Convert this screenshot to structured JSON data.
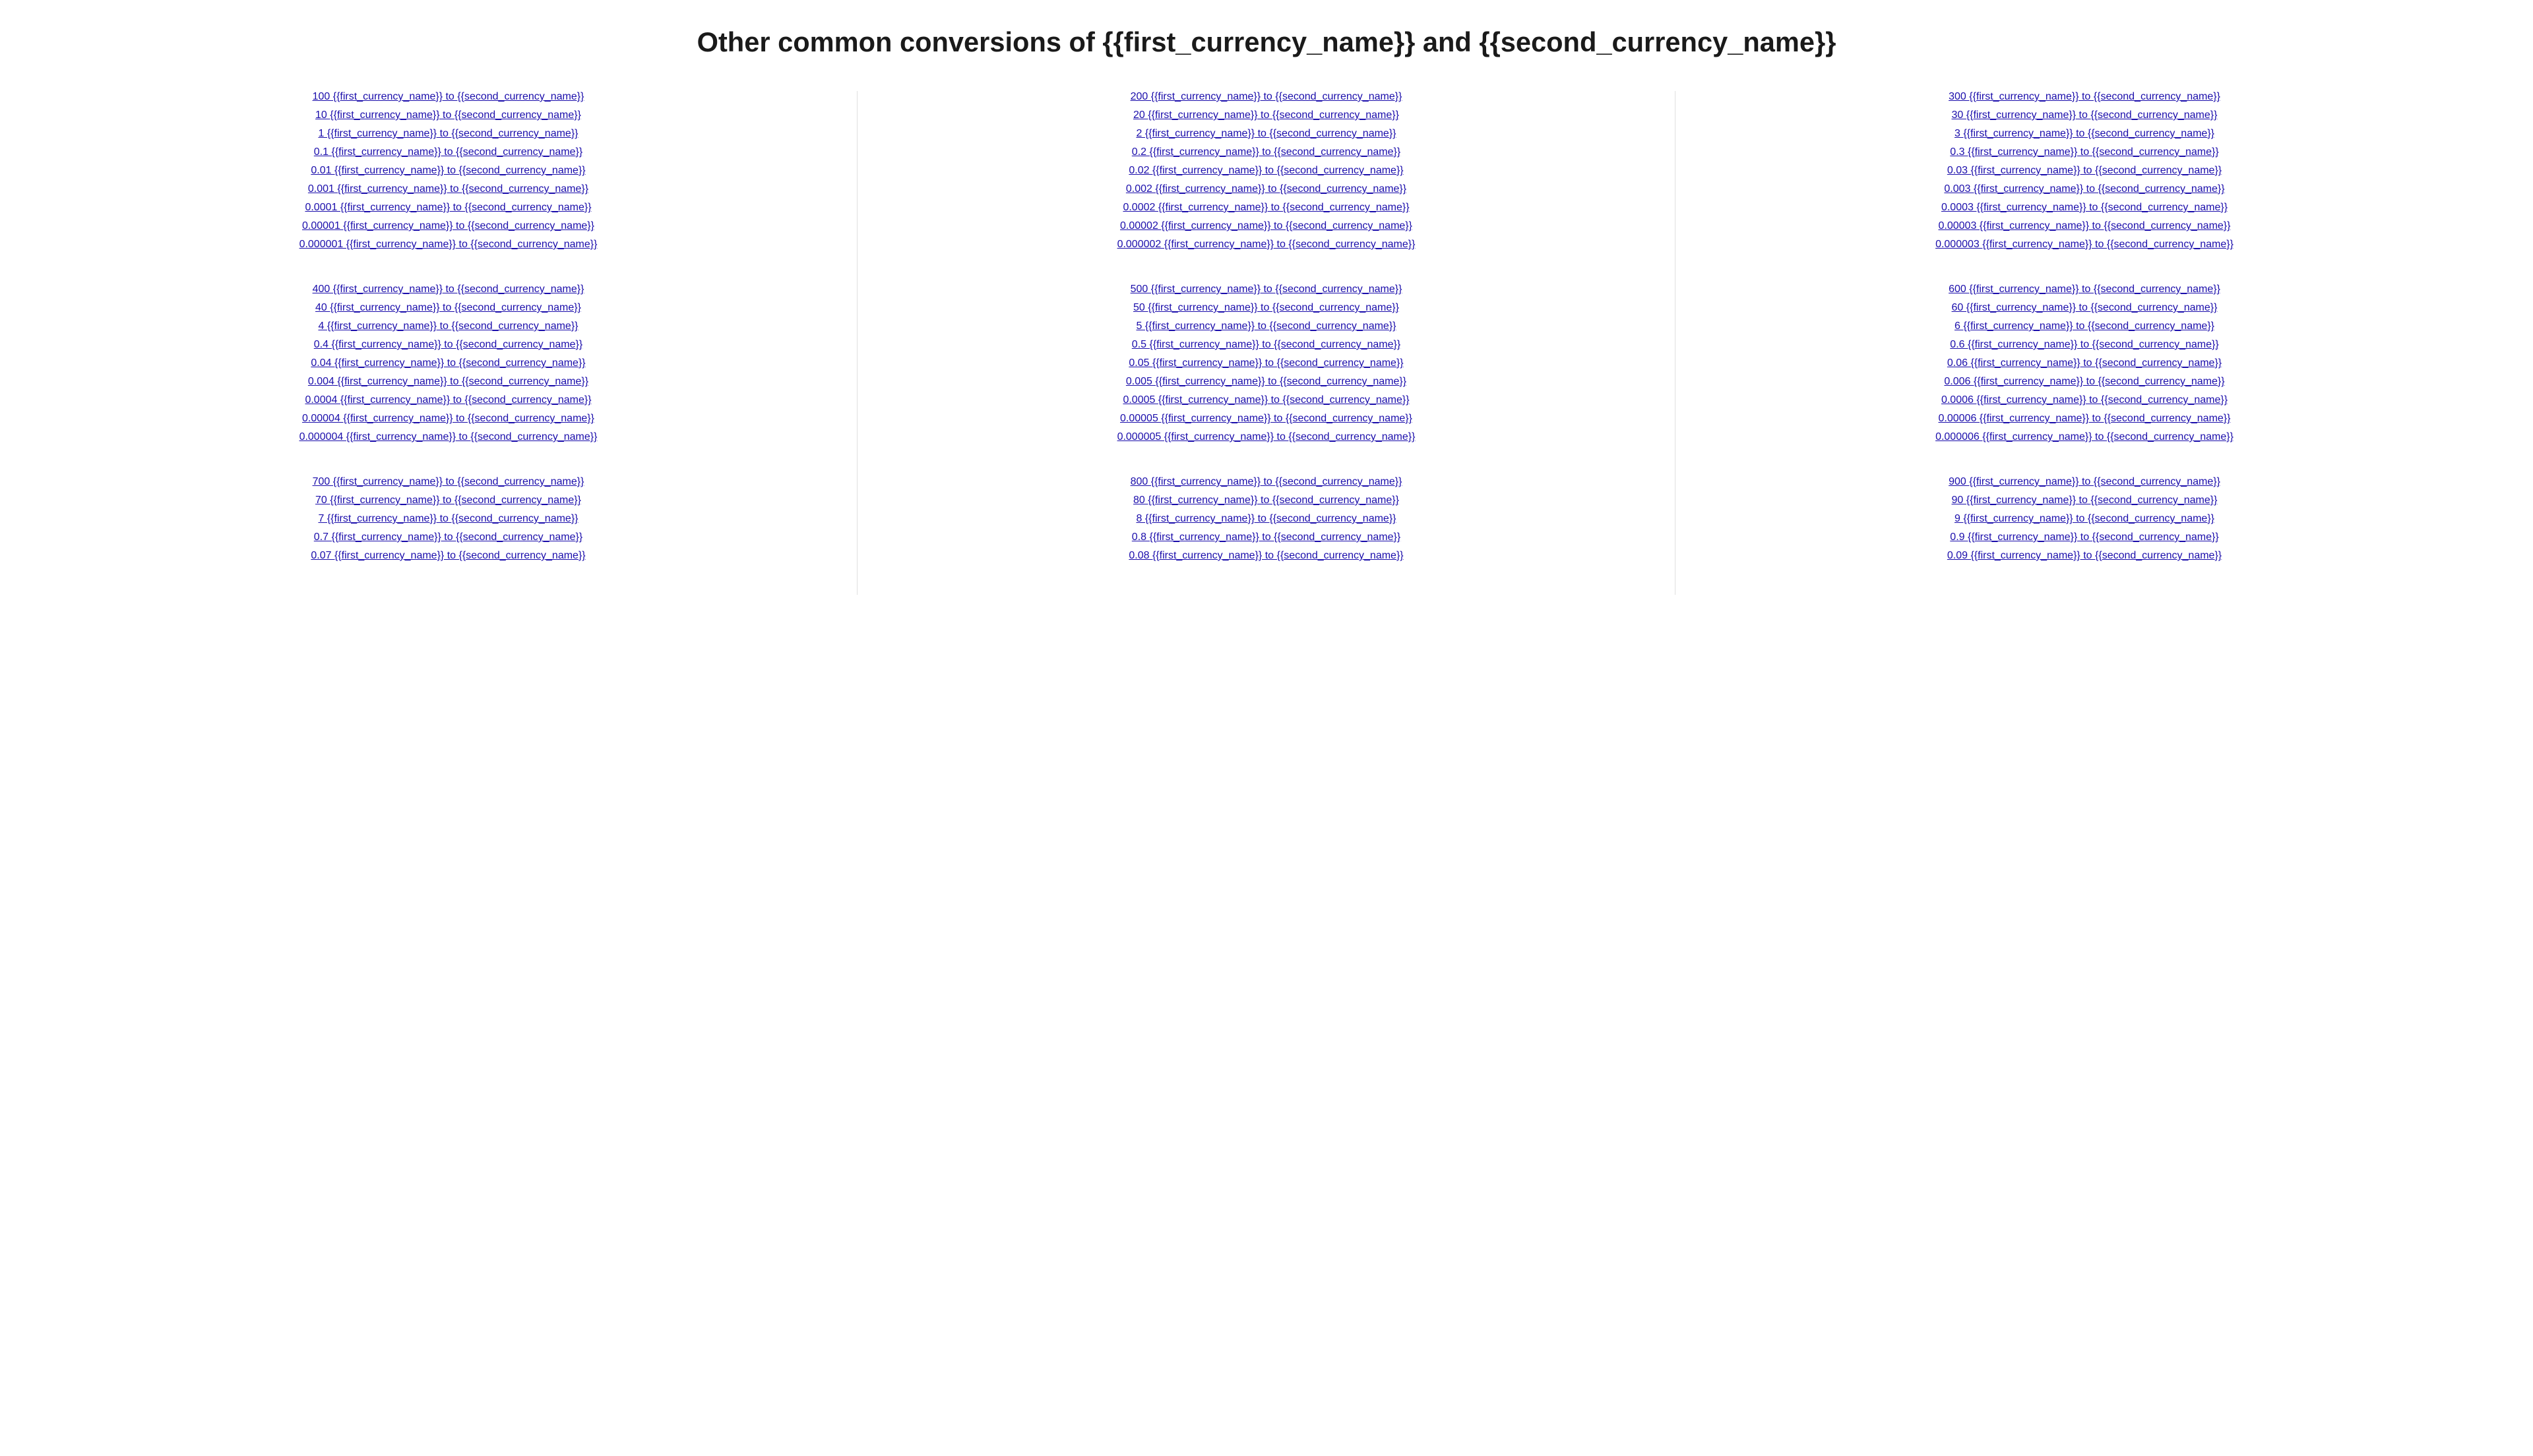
{
  "page": {
    "title": "Other common conversions of {{first_currency_name}} and {{second_currency_name}}"
  },
  "columns": [
    {
      "id": "col1",
      "groups": [
        {
          "id": "g1",
          "links": [
            "100 {{first_currency_name}} to {{second_currency_name}}",
            "10 {{first_currency_name}} to {{second_currency_name}}",
            "1 {{first_currency_name}} to {{second_currency_name}}",
            "0.1 {{first_currency_name}} to {{second_currency_name}}",
            "0.01 {{first_currency_name}} to {{second_currency_name}}",
            "0.001 {{first_currency_name}} to {{second_currency_name}}",
            "0.0001 {{first_currency_name}} to {{second_currency_name}}",
            "0.00001 {{first_currency_name}} to {{second_currency_name}}",
            "0.000001 {{first_currency_name}} to {{second_currency_name}}"
          ]
        },
        {
          "id": "g2",
          "links": [
            "400 {{first_currency_name}} to {{second_currency_name}}",
            "40 {{first_currency_name}} to {{second_currency_name}}",
            "4 {{first_currency_name}} to {{second_currency_name}}",
            "0.4 {{first_currency_name}} to {{second_currency_name}}",
            "0.04 {{first_currency_name}} to {{second_currency_name}}",
            "0.004 {{first_currency_name}} to {{second_currency_name}}",
            "0.0004 {{first_currency_name}} to {{second_currency_name}}",
            "0.00004 {{first_currency_name}} to {{second_currency_name}}",
            "0.000004 {{first_currency_name}} to {{second_currency_name}}"
          ]
        },
        {
          "id": "g3",
          "links": [
            "700 {{first_currency_name}} to {{second_currency_name}}",
            "70 {{first_currency_name}} to {{second_currency_name}}",
            "7 {{first_currency_name}} to {{second_currency_name}}",
            "0.7 {{first_currency_name}} to {{second_currency_name}}",
            "0.07 {{first_currency_name}} to {{second_currency_name}}"
          ]
        }
      ]
    },
    {
      "id": "col2",
      "groups": [
        {
          "id": "g1",
          "links": [
            "200 {{first_currency_name}} to {{second_currency_name}}",
            "20 {{first_currency_name}} to {{second_currency_name}}",
            "2 {{first_currency_name}} to {{second_currency_name}}",
            "0.2 {{first_currency_name}} to {{second_currency_name}}",
            "0.02 {{first_currency_name}} to {{second_currency_name}}",
            "0.002 {{first_currency_name}} to {{second_currency_name}}",
            "0.0002 {{first_currency_name}} to {{second_currency_name}}",
            "0.00002 {{first_currency_name}} to {{second_currency_name}}",
            "0.000002 {{first_currency_name}} to {{second_currency_name}}"
          ]
        },
        {
          "id": "g2",
          "links": [
            "500 {{first_currency_name}} to {{second_currency_name}}",
            "50 {{first_currency_name}} to {{second_currency_name}}",
            "5 {{first_currency_name}} to {{second_currency_name}}",
            "0.5 {{first_currency_name}} to {{second_currency_name}}",
            "0.05 {{first_currency_name}} to {{second_currency_name}}",
            "0.005 {{first_currency_name}} to {{second_currency_name}}",
            "0.0005 {{first_currency_name}} to {{second_currency_name}}",
            "0.00005 {{first_currency_name}} to {{second_currency_name}}",
            "0.000005 {{first_currency_name}} to {{second_currency_name}}"
          ]
        },
        {
          "id": "g3",
          "links": [
            "800 {{first_currency_name}} to {{second_currency_name}}",
            "80 {{first_currency_name}} to {{second_currency_name}}",
            "8 {{first_currency_name}} to {{second_currency_name}}",
            "0.8 {{first_currency_name}} to {{second_currency_name}}",
            "0.08 {{first_currency_name}} to {{second_currency_name}}"
          ]
        }
      ]
    },
    {
      "id": "col3",
      "groups": [
        {
          "id": "g1",
          "links": [
            "300 {{first_currency_name}} to {{second_currency_name}}",
            "30 {{first_currency_name}} to {{second_currency_name}}",
            "3 {{first_currency_name}} to {{second_currency_name}}",
            "0.3 {{first_currency_name}} to {{second_currency_name}}",
            "0.03 {{first_currency_name}} to {{second_currency_name}}",
            "0.003 {{first_currency_name}} to {{second_currency_name}}",
            "0.0003 {{first_currency_name}} to {{second_currency_name}}",
            "0.00003 {{first_currency_name}} to {{second_currency_name}}",
            "0.000003 {{first_currency_name}} to {{second_currency_name}}"
          ]
        },
        {
          "id": "g2",
          "links": [
            "600 {{first_currency_name}} to {{second_currency_name}}",
            "60 {{first_currency_name}} to {{second_currency_name}}",
            "6 {{first_currency_name}} to {{second_currency_name}}",
            "0.6 {{first_currency_name}} to {{second_currency_name}}",
            "0.06 {{first_currency_name}} to {{second_currency_name}}",
            "0.006 {{first_currency_name}} to {{second_currency_name}}",
            "0.0006 {{first_currency_name}} to {{second_currency_name}}",
            "0.00006 {{first_currency_name}} to {{second_currency_name}}",
            "0.000006 {{first_currency_name}} to {{second_currency_name}}"
          ]
        },
        {
          "id": "g3",
          "links": [
            "900 {{first_currency_name}} to {{second_currency_name}}",
            "90 {{first_currency_name}} to {{second_currency_name}}",
            "9 {{first_currency_name}} to {{second_currency_name}}",
            "0.9 {{first_currency_name}} to {{second_currency_name}}",
            "0.09 {{first_currency_name}} to {{second_currency_name}}"
          ]
        }
      ]
    }
  ]
}
